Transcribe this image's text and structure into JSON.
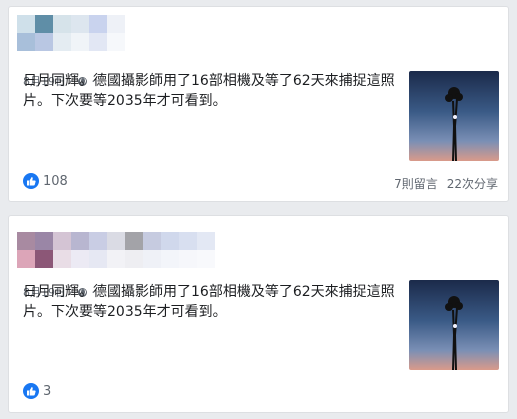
{
  "posts": [
    {
      "meta": {
        "date": "8月19日",
        "separator": "·"
      },
      "text": "日月同輝。德國攝影師用了16部相機及等了62天來捕捉這照片。下次要等2035年才可看到。",
      "reactions": {
        "count": "108"
      },
      "stats": {
        "comments": "7則留言",
        "shares": "22次分享"
      }
    },
    {
      "meta": {
        "date": "8月19日",
        "separator": "·"
      },
      "text": "日月同輝。德國攝影師用了16部相機及等了62天來捕捉這照片。下次要等2035年才可看到。",
      "reactions": {
        "count": "3"
      }
    }
  ],
  "colors": {
    "accent": "#1877f2",
    "secondary_text": "#606770",
    "background": "#e9ebee"
  },
  "icons": [
    "globe-icon",
    "like-icon"
  ]
}
